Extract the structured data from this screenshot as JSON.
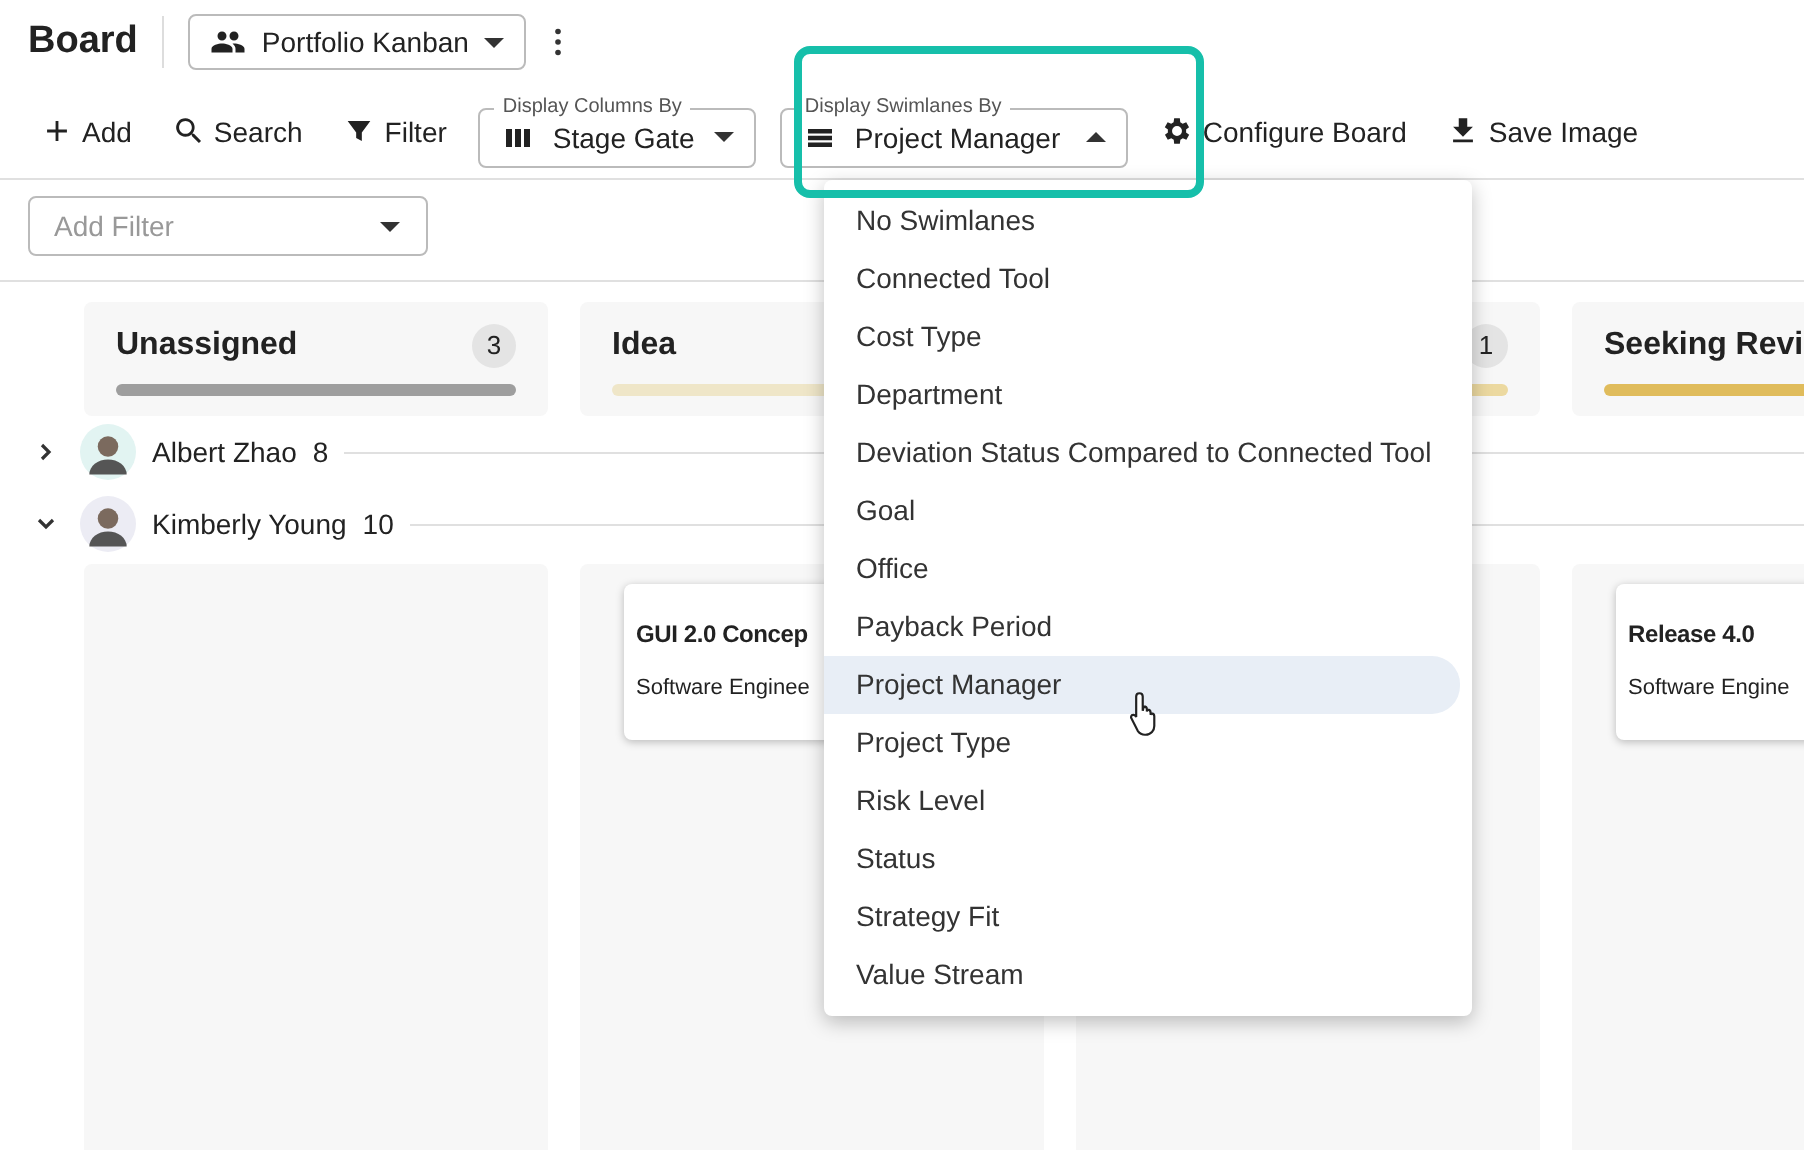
{
  "header": {
    "title": "Board",
    "view_button": "Portfolio Kanban"
  },
  "toolbar": [
    {
      "kind": "button",
      "label": "Add"
    },
    {
      "kind": "button",
      "label": "Search"
    },
    {
      "kind": "button",
      "label": "Filter"
    },
    {
      "kind": "select",
      "legend": "Display Columns By",
      "value": "Stage Gate",
      "expanded": false
    },
    {
      "kind": "select",
      "legend": "Display Swimlanes By",
      "value": "Project Manager",
      "expanded": true
    },
    {
      "kind": "button",
      "label": "Configure Board"
    },
    {
      "kind": "button",
      "label": "Save Image"
    }
  ],
  "filter_field": {
    "placeholder": "Add Filter"
  },
  "columns": [
    {
      "title": "Unassigned",
      "count": "3",
      "color": "#9e9e9e"
    },
    {
      "title": "Idea",
      "color": "#efe6c8"
    },
    {
      "count": "1",
      "color": "#ecd9a0"
    },
    {
      "title": "Seeking Revi",
      "color": "#e0bc5c"
    }
  ],
  "swimlanes": [
    {
      "name": "Albert Zhao",
      "count": "8",
      "expanded": false
    },
    {
      "name": "Kimberly Young",
      "count": "10",
      "expanded": true,
      "cells": [
        [],
        [
          {
            "title": "GUI 2.0 Concep",
            "subtitle": "Software Enginee"
          }
        ],
        [],
        [
          {
            "title": "Release 4.0",
            "subtitle": "Software Engine"
          }
        ]
      ]
    }
  ],
  "menu": {
    "items": [
      {
        "label": "No Swimlanes",
        "selected": false
      },
      {
        "label": "Connected Tool",
        "selected": false
      },
      {
        "label": "Cost Type",
        "selected": false
      },
      {
        "label": "Department",
        "selected": false
      },
      {
        "label": "Deviation Status Compared to Connected Tool",
        "selected": false
      },
      {
        "label": "Goal",
        "selected": false
      },
      {
        "label": "Office",
        "selected": false
      },
      {
        "label": "Payback Period",
        "selected": false
      },
      {
        "label": "Project Manager",
        "selected": true
      },
      {
        "label": "Project Type",
        "selected": false
      },
      {
        "label": "Risk Level",
        "selected": false
      },
      {
        "label": "Status",
        "selected": false
      },
      {
        "label": "Strategy Fit",
        "selected": false
      },
      {
        "label": "Value Stream",
        "selected": false
      }
    ]
  }
}
